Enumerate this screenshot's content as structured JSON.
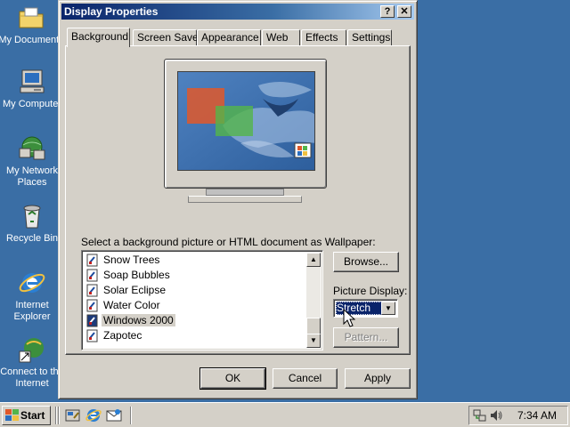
{
  "desktop": {
    "icons": [
      {
        "label": "My Documents",
        "icon": "folder-icon"
      },
      {
        "label": "My Computer",
        "icon": "computer-icon"
      },
      {
        "label": "My Network Places",
        "icon": "network-icon"
      },
      {
        "label": "Recycle Bin",
        "icon": "recycle-bin-icon"
      },
      {
        "label": "Internet Explorer",
        "icon": "internet-explorer-icon"
      },
      {
        "label": "Connect to the Internet",
        "icon": "connect-internet-icon"
      }
    ]
  },
  "dialog": {
    "title": "Display Properties",
    "help_label": "?",
    "close_label": "✕",
    "tabs": [
      {
        "label": "Background",
        "active": true
      },
      {
        "label": "Screen Saver",
        "active": false
      },
      {
        "label": "Appearance",
        "active": false
      },
      {
        "label": "Web",
        "active": false
      },
      {
        "label": "Effects",
        "active": false
      },
      {
        "label": "Settings",
        "active": false
      }
    ],
    "wallpaper_label": "Select a background picture or HTML document as Wallpaper:",
    "wallpapers": [
      {
        "label": "Snow Trees",
        "selected": false
      },
      {
        "label": "Soap Bubbles",
        "selected": false
      },
      {
        "label": "Solar Eclipse",
        "selected": false
      },
      {
        "label": "Water Color",
        "selected": false
      },
      {
        "label": "Windows 2000",
        "selected": true
      },
      {
        "label": "Zapotec",
        "selected": false
      }
    ],
    "browse_label": "Browse...",
    "picture_display_label": "Picture Display:",
    "picture_display_value": "Stretch",
    "pattern_label": "Pattern...",
    "ok_label": "OK",
    "cancel_label": "Cancel",
    "apply_label": "Apply"
  },
  "taskbar": {
    "start_label": "Start",
    "quick_launch": [
      "show-desktop-icon",
      "internet-explorer-icon",
      "outlook-express-icon"
    ],
    "clock": "7:34 AM"
  },
  "colors": {
    "desktop": "#3a6ea5",
    "titlebar": "#0a246a",
    "face": "#d4d0c8",
    "selection": "#0a246a"
  }
}
